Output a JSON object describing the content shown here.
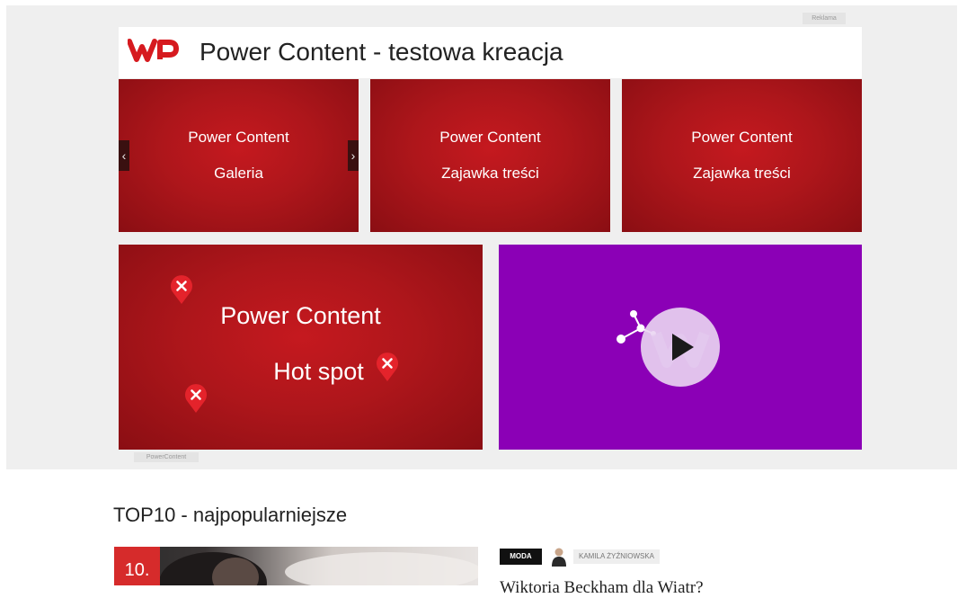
{
  "ad": {
    "label": "Reklama",
    "footer_label": "PowerContent",
    "header": {
      "logo": "wp-logo",
      "title": "Power Content - testowa kreacja"
    },
    "gallery_tile": {
      "line1": "Power Content",
      "line2": "Galeria",
      "prev_icon": "chevron-left-icon",
      "next_icon": "chevron-right-icon"
    },
    "teaser_tiles": [
      {
        "line1": "Power Content",
        "line2": "Zajawka treści"
      },
      {
        "line1": "Power Content",
        "line2": "Zajawka treści"
      }
    ],
    "hotspot_tile": {
      "line1": "Power Content",
      "line2": "Hot spot",
      "pin_icon": "close-pin-icon"
    },
    "video_tile": {
      "play_icon": "play-icon",
      "share_icon": "share-icon",
      "background": "#8b00b6"
    },
    "colors": {
      "brand_red": "#d61a1f",
      "tile_red": "#ae161b"
    }
  },
  "top10": {
    "title": "TOP10 - najpopularniejsze",
    "first_item": {
      "rank": "10.",
      "category": "MODA",
      "author": "KAMILA ŻYŹNIOWSKA",
      "author_icon": "person-icon",
      "title": "Wiktoria Beckham dla Wiatr?"
    }
  }
}
